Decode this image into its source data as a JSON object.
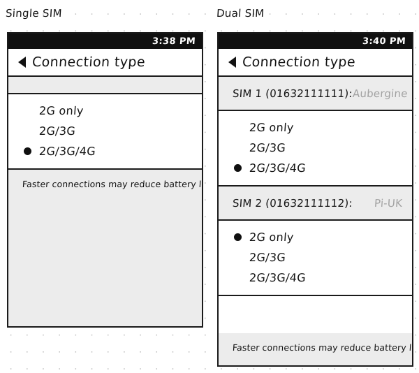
{
  "captions": {
    "single": "Single SIM",
    "dual": "Dual SIM"
  },
  "colors": {
    "ink": "#121212",
    "statusbar_bg": "#101010",
    "band_bg": "#ececec",
    "muted_text": "#a2a2a2",
    "panel_bg": "#ffffff"
  },
  "single_sim_phone": {
    "status_time": "3:38 PM",
    "back_icon": "back-arrow-icon",
    "title": "Connection type",
    "options": [
      {
        "label": "2G only",
        "selected": false
      },
      {
        "label": "2G/3G",
        "selected": false
      },
      {
        "label": "2G/3G/4G",
        "selected": true
      }
    ],
    "note": "Faster connections may reduce battery life."
  },
  "dual_sim_phone": {
    "status_time": "3:40 PM",
    "back_icon": "back-arrow-icon",
    "title": "Connection type",
    "sims": [
      {
        "label": "SIM 1 (01632111111):",
        "carrier": "Aubergine",
        "options": [
          {
            "label": "2G only",
            "selected": false
          },
          {
            "label": "2G/3G",
            "selected": false
          },
          {
            "label": "2G/3G/4G",
            "selected": true
          }
        ]
      },
      {
        "label": "SIM 2 (01632111112):",
        "carrier": "Pi-UK",
        "options": [
          {
            "label": "2G only",
            "selected": true
          },
          {
            "label": "2G/3G",
            "selected": false
          },
          {
            "label": "2G/3G/4G",
            "selected": false
          }
        ]
      }
    ],
    "note": "Faster connections may reduce battery life."
  }
}
